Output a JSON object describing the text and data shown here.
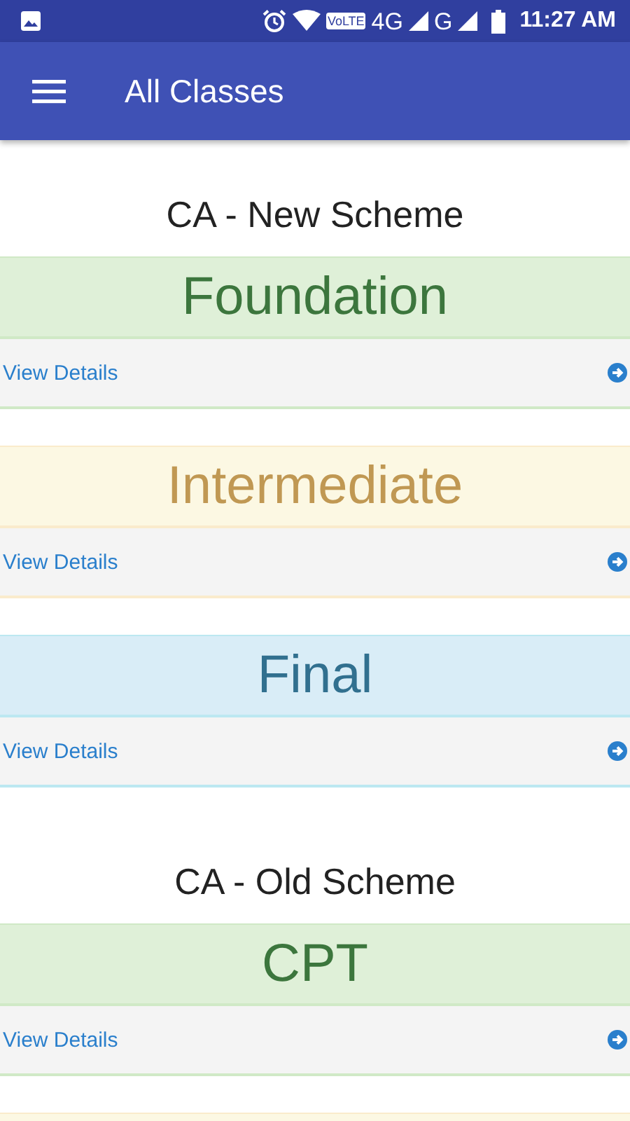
{
  "status_bar": {
    "volte": "VoLTE",
    "network_1": "4G",
    "network_2": "G",
    "time": "11:27 AM"
  },
  "app_bar": {
    "title": "All Classes"
  },
  "sections": [
    {
      "heading": "CA - New Scheme",
      "cards": [
        {
          "kind": "success",
          "title": "Foundation",
          "link": "View Details"
        },
        {
          "kind": "warning",
          "title": "Intermediate",
          "link": "View Details"
        },
        {
          "kind": "info",
          "title": "Final",
          "link": "View Details"
        }
      ]
    },
    {
      "heading": "CA - Old Scheme",
      "cards": [
        {
          "kind": "success",
          "title": "CPT",
          "link": "View Details"
        },
        {
          "kind": "warning"
        }
      ]
    }
  ]
}
